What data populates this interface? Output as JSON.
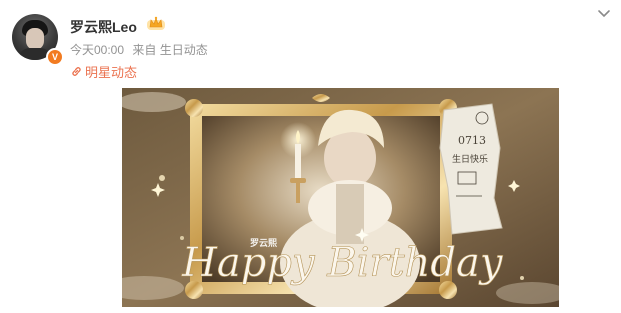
{
  "post": {
    "author": {
      "name": "罗云熙Leo",
      "avatar_icon": "avatar-photo-icon",
      "verified_icon": "verified-v-icon",
      "member_icon": "member-crown-icon"
    },
    "meta": {
      "time": "今天00:00",
      "source_prefix": "来自",
      "source": "生日动态"
    },
    "topic": {
      "icon": "link-icon",
      "label": "明星动态"
    },
    "more_icon": "chevron-down-icon",
    "image": {
      "script_text": "Happy Birthday",
      "name_stamp": "罗云熙",
      "note_text": "0713",
      "note_text_2": "生日快乐"
    }
  },
  "colors": {
    "accent": "#eb7350",
    "meta": "#939393",
    "name": "#333333",
    "verified": "#f27b21"
  }
}
